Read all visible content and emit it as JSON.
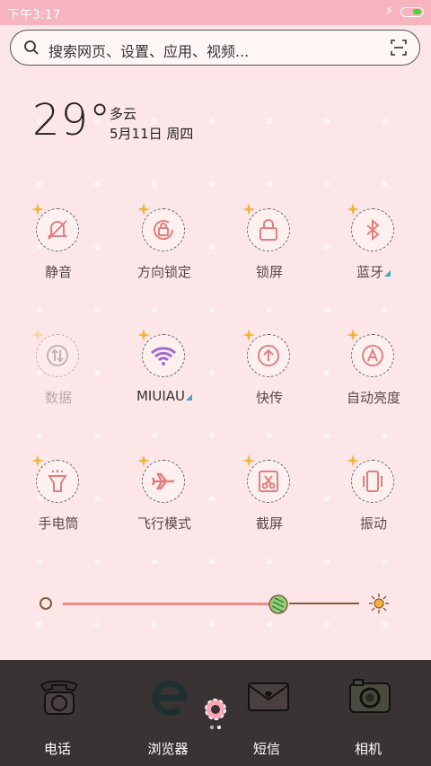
{
  "status": {
    "time": "下午3:17",
    "battery_color": "#4cd137"
  },
  "search": {
    "placeholder": "搜索网页、设置、应用、视频..."
  },
  "weather": {
    "temp": "29°",
    "condition": "多云",
    "date": "5月11日 周四"
  },
  "toggles": [
    {
      "label": "静音",
      "icon": "mute-icon"
    },
    {
      "label": "方向锁定",
      "icon": "rotation-lock-icon"
    },
    {
      "label": "锁屏",
      "icon": "lock-icon"
    },
    {
      "label": "蓝牙",
      "icon": "bluetooth-icon"
    },
    {
      "label": "数据",
      "icon": "data-icon"
    },
    {
      "label": "MIUIAU",
      "icon": "wifi-icon"
    },
    {
      "label": "快传",
      "icon": "transfer-icon"
    },
    {
      "label": "自动亮度",
      "icon": "auto-brightness-icon"
    },
    {
      "label": "手电筒",
      "icon": "flashlight-icon"
    },
    {
      "label": "飞行模式",
      "icon": "airplane-icon"
    },
    {
      "label": "截屏",
      "icon": "screenshot-icon"
    },
    {
      "label": "振动",
      "icon": "vibrate-icon"
    }
  ],
  "brightness": {
    "level": 0.7
  },
  "dock": [
    {
      "label": "电话",
      "icon": "phone-icon"
    },
    {
      "label": "浏览器",
      "icon": "browser-icon"
    },
    {
      "label": "短信",
      "icon": "message-icon"
    },
    {
      "label": "相机",
      "icon": "camera-icon"
    }
  ]
}
